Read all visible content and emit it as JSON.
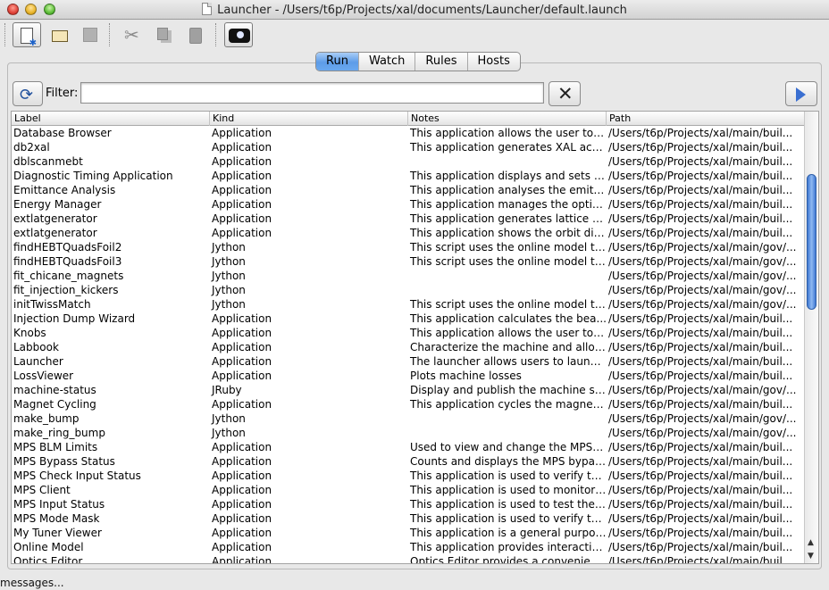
{
  "window": {
    "title": "Launcher - /Users/t6p/Projects/xal/documents/Launcher/default.launch"
  },
  "toolbar": {
    "buttons": [
      "new-document-icon",
      "open-folder-icon",
      "save-icon",
      "cut-icon",
      "copy-icon",
      "paste-icon",
      "projector-icon"
    ]
  },
  "tabs": [
    {
      "label": "Run",
      "selected": true
    },
    {
      "label": "Watch",
      "selected": false
    },
    {
      "label": "Rules",
      "selected": false
    },
    {
      "label": "Hosts",
      "selected": false
    }
  ],
  "filter": {
    "label": "Filter:",
    "value": ""
  },
  "table": {
    "columns": [
      "Label",
      "Kind",
      "Notes",
      "Path"
    ],
    "rows": [
      [
        "Database Browser",
        "Application",
        "This application allows the user to ...",
        "/Users/t6p/Projects/xal/main/buil..."
      ],
      [
        "db2xal",
        "Application",
        "This application generates XAL acc...",
        "/Users/t6p/Projects/xal/main/buil..."
      ],
      [
        "dblscanmebt",
        "Application",
        "",
        "/Users/t6p/Projects/xal/main/buil..."
      ],
      [
        "Diagnostic Timing Application",
        "Application",
        "This application displays and sets s...",
        "/Users/t6p/Projects/xal/main/buil..."
      ],
      [
        "Emittance Analysis",
        "Application",
        "This application analyses the emitta...",
        "/Users/t6p/Projects/xal/main/buil..."
      ],
      [
        "Energy Manager",
        "Application",
        "This application manages the optics...",
        "/Users/t6p/Projects/xal/main/buil..."
      ],
      [
        "extlatgenerator",
        "Application",
        "This application generates lattice fil...",
        "/Users/t6p/Projects/xal/main/buil..."
      ],
      [
        "extlatgenerator",
        "Application",
        "This application shows the orbit diff...",
        "/Users/t6p/Projects/xal/main/buil..."
      ],
      [
        "findHEBTQuadsFoil2",
        "Jython",
        "This script uses the online model to...",
        "/Users/t6p/Projects/xal/main/gov/..."
      ],
      [
        "findHEBTQuadsFoil3",
        "Jython",
        "This script uses the online model to...",
        "/Users/t6p/Projects/xal/main/gov/..."
      ],
      [
        "fit_chicane_magnets",
        "Jython",
        "",
        "/Users/t6p/Projects/xal/main/gov/..."
      ],
      [
        "fit_injection_kickers",
        "Jython",
        "",
        "/Users/t6p/Projects/xal/main/gov/..."
      ],
      [
        "initTwissMatch",
        "Jython",
        "This script uses the online model to...",
        "/Users/t6p/Projects/xal/main/gov/..."
      ],
      [
        "Injection Dump Wizard",
        "Application",
        "This application calculates the bea...",
        "/Users/t6p/Projects/xal/main/buil..."
      ],
      [
        "Knobs",
        "Application",
        "This application allows the user to ...",
        "/Users/t6p/Projects/xal/main/buil..."
      ],
      [
        "Labbook",
        "Application",
        "Characterize the machine and allow...",
        "/Users/t6p/Projects/xal/main/buil..."
      ],
      [
        "Launcher",
        "Application",
        "The launcher allows users to launch...",
        "/Users/t6p/Projects/xal/main/buil..."
      ],
      [
        "LossViewer",
        "Application",
        "Plots machine losses",
        "/Users/t6p/Projects/xal/main/buil..."
      ],
      [
        "machine-status",
        "JRuby",
        "Display and publish the machine st...",
        "/Users/t6p/Projects/xal/main/gov/..."
      ],
      [
        "Magnet Cycling",
        "Application",
        "This application cycles the magnet t...",
        "/Users/t6p/Projects/xal/main/buil..."
      ],
      [
        "make_bump",
        "Jython",
        "",
        "/Users/t6p/Projects/xal/main/gov/..."
      ],
      [
        "make_ring_bump",
        "Jython",
        "",
        "/Users/t6p/Projects/xal/main/gov/..."
      ],
      [
        "MPS BLM Limits",
        "Application",
        "Used to view and change the MPS B...",
        "/Users/t6p/Projects/xal/main/buil..."
      ],
      [
        "MPS Bypass Status",
        "Application",
        "Counts and displays the MPS bypas...",
        "/Users/t6p/Projects/xal/main/buil..."
      ],
      [
        "MPS Check Input Status",
        "Application",
        "This application is used to verify th...",
        "/Users/t6p/Projects/xal/main/buil..."
      ],
      [
        "MPS Client",
        "Application",
        "This application is used to monitor t...",
        "/Users/t6p/Projects/xal/main/buil..."
      ],
      [
        "MPS Input Status",
        "Application",
        "This application is used to test the ...",
        "/Users/t6p/Projects/xal/main/buil..."
      ],
      [
        "MPS Mode Mask",
        "Application",
        "This application is used to verify th...",
        "/Users/t6p/Projects/xal/main/buil..."
      ],
      [
        "My Tuner Viewer",
        "Application",
        "This application is a general purpos...",
        "/Users/t6p/Projects/xal/main/buil..."
      ],
      [
        "Online Model",
        "Application",
        "This application provides interactiv...",
        "/Users/t6p/Projects/xal/main/buil..."
      ],
      [
        "Optics Editor",
        "Application",
        "Optics Editor provides a convenient...",
        "/Users/t6p/Projects/xal/main/buil..."
      ]
    ]
  },
  "status": {
    "text": "messages..."
  },
  "colors": {
    "selected_tab": "#5d9ce8",
    "scroll_thumb": "#3f79d3",
    "run_arrow": "#3a6fd1"
  }
}
